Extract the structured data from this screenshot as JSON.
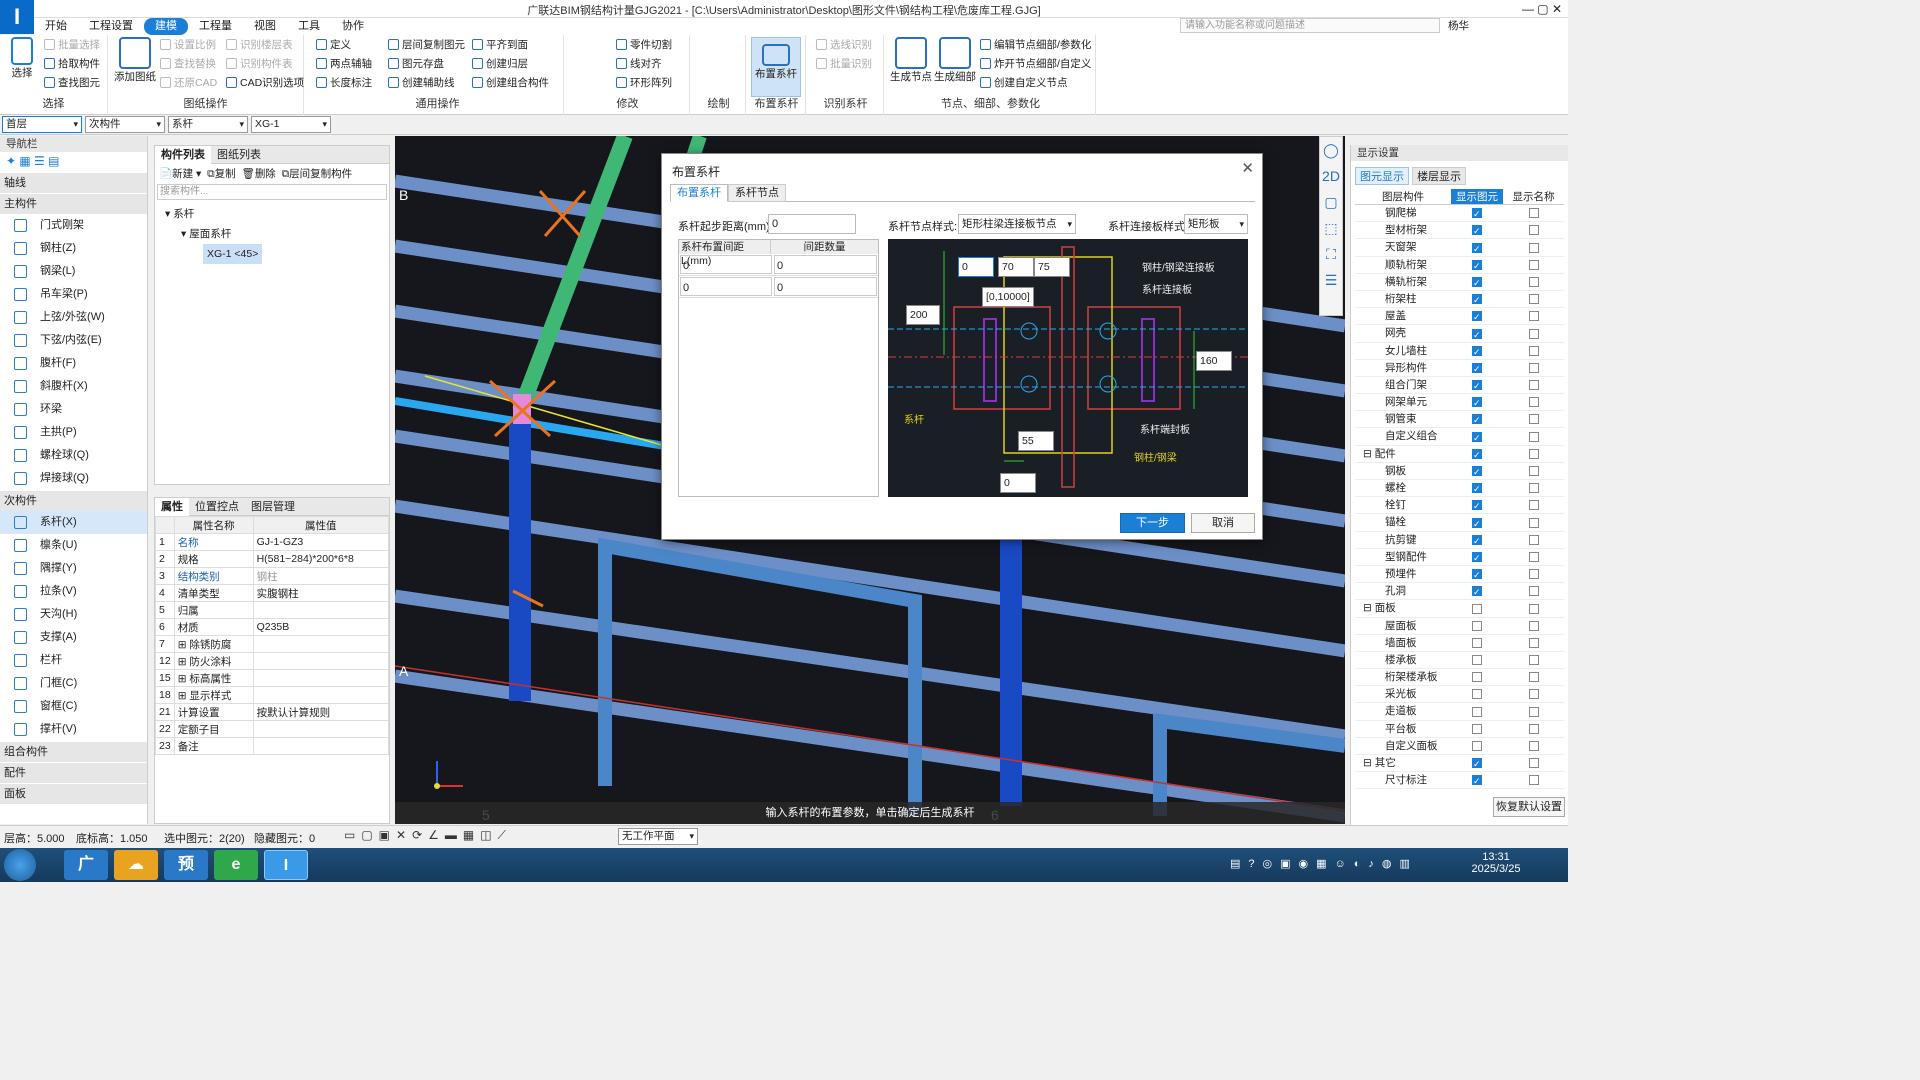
{
  "title": "广联达BIM钢结构计量GJG2021 - [C:\\Users\\Administrator\\Desktop\\图形文件\\钢结构工程\\危废库工程.GJG]",
  "menu": [
    "开始",
    "工程设置",
    "建模",
    "工程量",
    "视图",
    "工具",
    "协作"
  ],
  "search_placeholder": "请输入功能名称或问题描述",
  "user": "杨华",
  "ribbon": {
    "select": {
      "big": "选择",
      "items": [
        "批量选择",
        "拾取构件",
        "查找图元"
      ],
      "label": "选择"
    },
    "drawing": {
      "big": "添加图纸",
      "items": [
        "设置比例",
        "查找替换",
        "还原CAD",
        "识别楼层表",
        "识别构件表",
        "CAD识别选项"
      ],
      "label": "图纸操作"
    },
    "general": {
      "items": [
        "定义",
        "两点辅轴",
        "长度标注",
        "层间复制图元",
        "图元存盘",
        "创建辅助线",
        "平齐到面",
        "创建归层",
        "创建组合构件"
      ],
      "label": "通用操作"
    },
    "modify": {
      "items": [
        "零件切割",
        "线对齐",
        "环形阵列"
      ],
      "label": "修改"
    },
    "draw": {
      "label": "绘制"
    },
    "layout": {
      "big": "布置系杆",
      "label": "布置系杆"
    },
    "identify": {
      "items": [
        "选线识别",
        "批量识别"
      ],
      "label": "识别系杆"
    },
    "node": {
      "bigs": [
        "生成节点",
        "生成细部"
      ],
      "items": [
        "编辑节点细部/参数化",
        "炸开节点细部/自定义",
        "创建自定义节点"
      ],
      "label": "节点、细部、参数化"
    }
  },
  "selbar": [
    "首层",
    "次构件",
    "系杆",
    "XG-1"
  ],
  "nav": {
    "title": "导航栏",
    "axis": "轴线",
    "main_section": "主构件",
    "main_items": [
      "门式刚架",
      "钢柱(Z)",
      "钢梁(L)",
      "吊车梁(P)",
      "上弦/外弦(W)",
      "下弦/内弦(E)",
      "腹杆(F)",
      "斜腹杆(X)",
      "环梁",
      "主拱(P)",
      "螺栓球(Q)",
      "焊接球(Q)"
    ],
    "sub_section": "次构件",
    "sub_items": [
      "系杆(X)",
      "檩条(U)",
      "隅撑(Y)",
      "拉条(V)",
      "天沟(H)",
      "支撑(A)",
      "栏杆",
      "门框(C)",
      "窗框(C)",
      "撑杆(V)"
    ],
    "bottom_sections": [
      "组合构件",
      "配件",
      "面板"
    ]
  },
  "complist": {
    "tabs": [
      "构件列表",
      "图纸列表"
    ],
    "toolbar": [
      "新建",
      "复制",
      "删除",
      "层间复制构件"
    ],
    "search_placeholder": "搜索构件...",
    "tree": [
      "系杆",
      "屋面系杆",
      "XG-1 <45>"
    ]
  },
  "props": {
    "tabs": [
      "属性",
      "位置控点",
      "图层管理"
    ],
    "headers": [
      "属性名称",
      "属性值"
    ],
    "rows": [
      {
        "n": "1",
        "name": "名称",
        "val": "GJ-1-GZ3"
      },
      {
        "n": "2",
        "name": "规格",
        "val": "H(581~284)*200*6*8"
      },
      {
        "n": "3",
        "name": "结构类别",
        "val": "钢柱"
      },
      {
        "n": "4",
        "name": "清单类型",
        "val": "实腹钢柱"
      },
      {
        "n": "5",
        "name": "归属",
        "val": ""
      },
      {
        "n": "6",
        "name": "材质",
        "val": "Q235B"
      },
      {
        "n": "7",
        "name": "除锈防腐",
        "val": ""
      },
      {
        "n": "12",
        "name": "防火涂料",
        "val": ""
      },
      {
        "n": "15",
        "name": "标高属性",
        "val": ""
      },
      {
        "n": "18",
        "name": "显示样式",
        "val": ""
      },
      {
        "n": "21",
        "name": "计算设置",
        "val": "按默认计算规则"
      },
      {
        "n": "22",
        "name": "定额子目",
        "val": ""
      },
      {
        "n": "23",
        "name": "备注",
        "val": ""
      }
    ]
  },
  "viewport": {
    "axis_labels": [
      "B",
      "A",
      "5",
      "6"
    ],
    "hint": "输入系杆的布置参数，单击确定后生成系杆"
  },
  "dialog": {
    "title": "布置系杆",
    "tabs": [
      "布置系杆",
      "系杆节点"
    ],
    "start_label": "系杆起步距离(mm):",
    "start_value": "0",
    "node_style_label": "系杆节点样式:",
    "node_style_value": "矩形柱梁连接板节点",
    "plate_style_label": "系杆连接板样式:",
    "plate_style_value": "矩形板",
    "grid_headers": [
      "系杆布置间距L(mm)",
      "间距数量"
    ],
    "grid_rows": [
      [
        "0",
        "0"
      ],
      [
        "0",
        "0"
      ]
    ],
    "diagram": {
      "dims": [
        "0",
        "70",
        "75",
        "[0,10000]",
        "200",
        "160",
        "55",
        "0"
      ],
      "labels": [
        "钢柱/钢梁连接板",
        "系杆连接板",
        "系杆",
        "系杆端封板",
        "钢柱/钢梁"
      ]
    },
    "next": "下一步",
    "cancel": "取消"
  },
  "dispset": {
    "title": "显示设置",
    "tabs": [
      "图元显示",
      "楼层显示"
    ],
    "headers": [
      "图层构件",
      "显示图元",
      "显示名称"
    ],
    "rows": [
      {
        "name": "钢爬梯",
        "show": true,
        "nm": false,
        "g": false
      },
      {
        "name": "型材桁架",
        "show": true,
        "nm": false,
        "g": false
      },
      {
        "name": "天窗架",
        "show": true,
        "nm": false,
        "g": false
      },
      {
        "name": "顺轨桁架",
        "show": true,
        "nm": false,
        "g": false
      },
      {
        "name": "横轨桁架",
        "show": true,
        "nm": false,
        "g": false
      },
      {
        "name": "桁架柱",
        "show": true,
        "nm": false,
        "g": false
      },
      {
        "name": "屋盖",
        "show": true,
        "nm": false,
        "g": false
      },
      {
        "name": "网壳",
        "show": true,
        "nm": false,
        "g": false
      },
      {
        "name": "女儿墙柱",
        "show": true,
        "nm": false,
        "g": false
      },
      {
        "name": "异形构件",
        "show": true,
        "nm": false,
        "g": false
      },
      {
        "name": "组合门架",
        "show": true,
        "nm": false,
        "g": false
      },
      {
        "name": "网架单元",
        "show": true,
        "nm": false,
        "g": false
      },
      {
        "name": "钢管束",
        "show": true,
        "nm": false,
        "g": false
      },
      {
        "name": "自定义组合",
        "show": true,
        "nm": false,
        "g": false
      },
      {
        "name": "配件",
        "show": true,
        "nm": false,
        "g": true
      },
      {
        "name": "钢板",
        "show": true,
        "nm": false,
        "g": false
      },
      {
        "name": "螺栓",
        "show": true,
        "nm": false,
        "g": false
      },
      {
        "name": "栓钉",
        "show": true,
        "nm": false,
        "g": false
      },
      {
        "name": "锚栓",
        "show": true,
        "nm": false,
        "g": false
      },
      {
        "name": "抗剪键",
        "show": true,
        "nm": false,
        "g": false
      },
      {
        "name": "型钢配件",
        "show": true,
        "nm": false,
        "g": false
      },
      {
        "name": "预埋件",
        "show": true,
        "nm": false,
        "g": false
      },
      {
        "name": "孔洞",
        "show": true,
        "nm": false,
        "g": false
      },
      {
        "name": "面板",
        "show": false,
        "nm": false,
        "g": true
      },
      {
        "name": "屋面板",
        "show": false,
        "nm": false,
        "g": false
      },
      {
        "name": "墙面板",
        "show": false,
        "nm": false,
        "g": false
      },
      {
        "name": "楼承板",
        "show": false,
        "nm": false,
        "g": false
      },
      {
        "name": "桁架楼承板",
        "show": false,
        "nm": false,
        "g": false
      },
      {
        "name": "采光板",
        "show": false,
        "nm": false,
        "g": false
      },
      {
        "name": "走道板",
        "show": false,
        "nm": false,
        "g": false
      },
      {
        "name": "平台板",
        "show": false,
        "nm": false,
        "g": false
      },
      {
        "name": "自定义面板",
        "show": false,
        "nm": false,
        "g": false
      },
      {
        "name": "其它",
        "show": true,
        "nm": false,
        "g": true
      },
      {
        "name": "尺寸标注",
        "show": true,
        "nm": false,
        "g": false
      }
    ],
    "restore": "恢复默认设置"
  },
  "status": {
    "floor_h": "层高：5.000",
    "bottom_h": "底标高：1.050",
    "selected": "选中图元：2(20)",
    "hidden": "隐藏图元：0",
    "plane": "无工作平面"
  },
  "taskbar": {
    "time": "13:31",
    "date": "2025/3/25",
    "apps": [
      "广",
      "预",
      "I"
    ]
  },
  "colors": {
    "accent": "#1b7fd6",
    "viewport_bg": "#15171c",
    "beam": "#6d8fc8",
    "column": "#1a49c4"
  }
}
